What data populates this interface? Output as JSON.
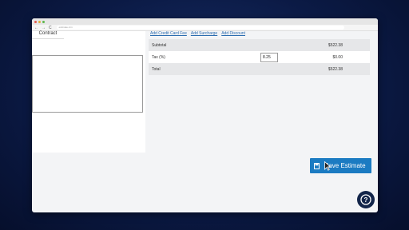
{
  "browser": {
    "url": "estimate.crm",
    "nav": {
      "back": "←",
      "forward": "→",
      "reload": "C"
    }
  },
  "tabs": {
    "contract_label": "Contract"
  },
  "links": {
    "add_credit_card_fee": "Add Credit Card Fee",
    "add_surcharge": "Add Surcharge",
    "add_discount": "Add Discount"
  },
  "summary": {
    "subtotal_label": "Subtotal",
    "subtotal_value": "$522.38",
    "tax_label": "Tax (%)",
    "tax_input_value": "8.25",
    "tax_value": "$0.00",
    "total_label": "Total",
    "total_value": "$522.38"
  },
  "actions": {
    "save_label": "Save Estimate"
  },
  "help": {
    "label": "?"
  },
  "colors": {
    "accent": "#1b7bc2",
    "help_bg": "#13254a",
    "link": "#2b6cb0"
  },
  "icons": {
    "save": "save-icon",
    "help": "help-icon",
    "cursor": "cursor-icon"
  }
}
